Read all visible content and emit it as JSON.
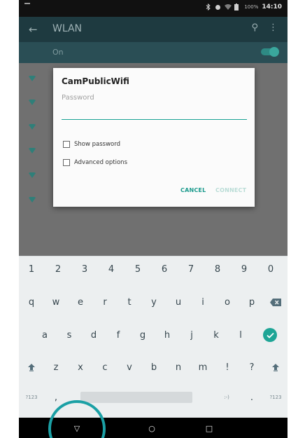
{
  "status_bar": {
    "battery": "100%",
    "time": "14:10",
    "icons": [
      "bluetooth-icon",
      "alarm-icon",
      "wifi-icon",
      "battery-icon"
    ]
  },
  "app_bar": {
    "back_icon": "arrow-left-icon",
    "back_glyph": "←",
    "title": "WLAN",
    "search_glyph": "⚲",
    "more_glyph": "⋮"
  },
  "wifi_toggle": {
    "label": "On",
    "state": "on"
  },
  "network_list": {
    "rows": 6,
    "icon": "wifi-signal-icon"
  },
  "dialog": {
    "title": "CamPublicWifi",
    "password_placeholder": "Password",
    "password_value": "",
    "show_password_label": "Show password",
    "advanced_options_label": "Advanced options",
    "cancel_label": "CANCEL",
    "connect_label": "CONNECT"
  },
  "keyboard": {
    "number_row": [
      "1",
      "2",
      "3",
      "4",
      "5",
      "6",
      "7",
      "8",
      "9",
      "0"
    ],
    "row1": [
      "q",
      "w",
      "e",
      "r",
      "t",
      "y",
      "u",
      "i",
      "o",
      "p"
    ],
    "row2": [
      "a",
      "s",
      "d",
      "f",
      "g",
      "h",
      "j",
      "k",
      "l"
    ],
    "row3": [
      "z",
      "x",
      "c",
      "v",
      "b",
      "n",
      "m",
      "!",
      "?"
    ],
    "symbols_left": "?123",
    "comma": ",",
    "emoticon": ":-)",
    "period": ".",
    "symbols_right": "?123",
    "accent_color": "#1ea596"
  },
  "nav_bar": {
    "back_glyph": "▽",
    "home_glyph": "○",
    "recents_glyph": "□"
  },
  "colors": {
    "accent": "#1a9a8c",
    "highlight_ring": "#1ba0a5"
  }
}
